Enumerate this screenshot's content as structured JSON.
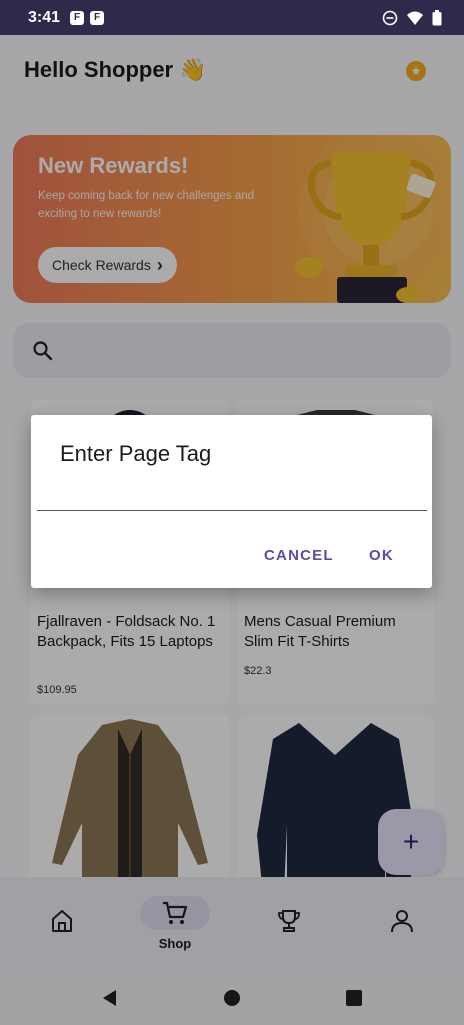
{
  "status_bar": {
    "time": "3:41"
  },
  "header": {
    "greeting": "Hello Shopper 👋"
  },
  "banner": {
    "title": "New Rewards!",
    "subtitle": "Keep coming back for new challenges and exciting to new rewards!",
    "button_label": "Check Rewards",
    "button_chevron": "›"
  },
  "search": {
    "placeholder": ""
  },
  "products": [
    {
      "name": "Fjallraven - Foldsack No. 1 Backpack, Fits 15 Laptops",
      "price": "$109.95"
    },
    {
      "name": "Mens Casual Premium Slim Fit T-Shirts",
      "price": "$22.3"
    },
    {
      "name": "",
      "price": ""
    },
    {
      "name": "",
      "price": ""
    }
  ],
  "fab": {
    "icon": "plus-icon",
    "label": "+"
  },
  "bottom_nav": [
    {
      "label": "",
      "icon": "home-icon",
      "active": false
    },
    {
      "label": "Shop",
      "icon": "cart-icon",
      "active": true
    },
    {
      "label": "",
      "icon": "trophy-icon",
      "active": false
    },
    {
      "label": "",
      "icon": "person-icon",
      "active": false
    }
  ],
  "dialog": {
    "title": "Enter Page Tag",
    "input_value": "",
    "cancel_label": "CANCEL",
    "ok_label": "OK"
  },
  "colors": {
    "accent": "#5a4ea8",
    "status_bar": "#2e2a4c",
    "banner_start": "#f07a5a",
    "banner_end": "#f9c052"
  }
}
